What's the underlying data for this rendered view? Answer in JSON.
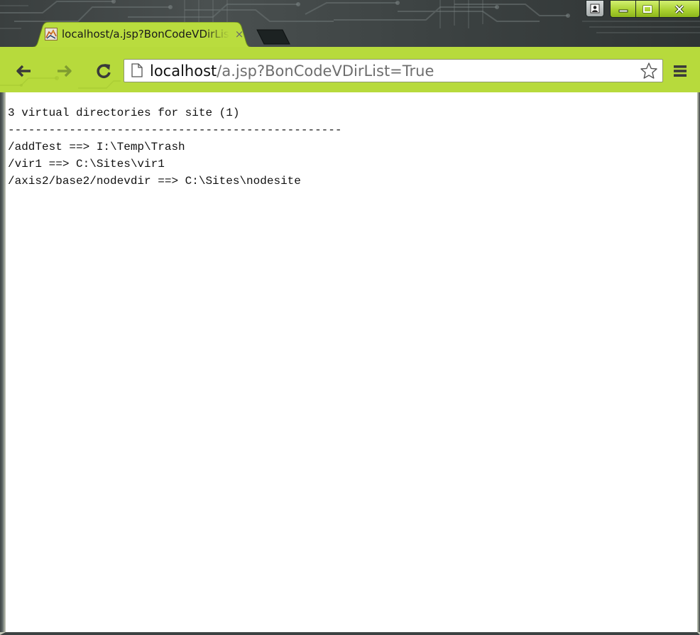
{
  "tab": {
    "title": "localhost/a.jsp?BonCodeVDirList=True",
    "close_glyph": "×"
  },
  "address_bar": {
    "host": "localhost",
    "path": "/a.jsp?BonCodeVDirList=True"
  },
  "icons": {
    "favicon": "tomcat-logo-icon",
    "back": "back-arrow-icon",
    "forward": "forward-arrow-icon",
    "reload": "reload-icon",
    "page": "page-icon",
    "bookmark": "star-icon",
    "menu": "hamburger-menu-icon",
    "profile": "user-profile-icon",
    "minimize": "minimize-icon",
    "maximize": "maximize-icon",
    "close": "close-icon"
  },
  "colors": {
    "toolbar": "#b7da3c",
    "frame": "#3d4343",
    "window_buttons": "#a8cf2e"
  },
  "page": {
    "lines": [
      "3 virtual directories for site (1)",
      "-------------------------------------------------",
      "/addTest ==> I:\\Temp\\Trash",
      "/vir1 ==> C:\\Sites\\vir1",
      "/axis2/base2/nodevdir ==> C:\\Sites\\nodesite"
    ]
  }
}
